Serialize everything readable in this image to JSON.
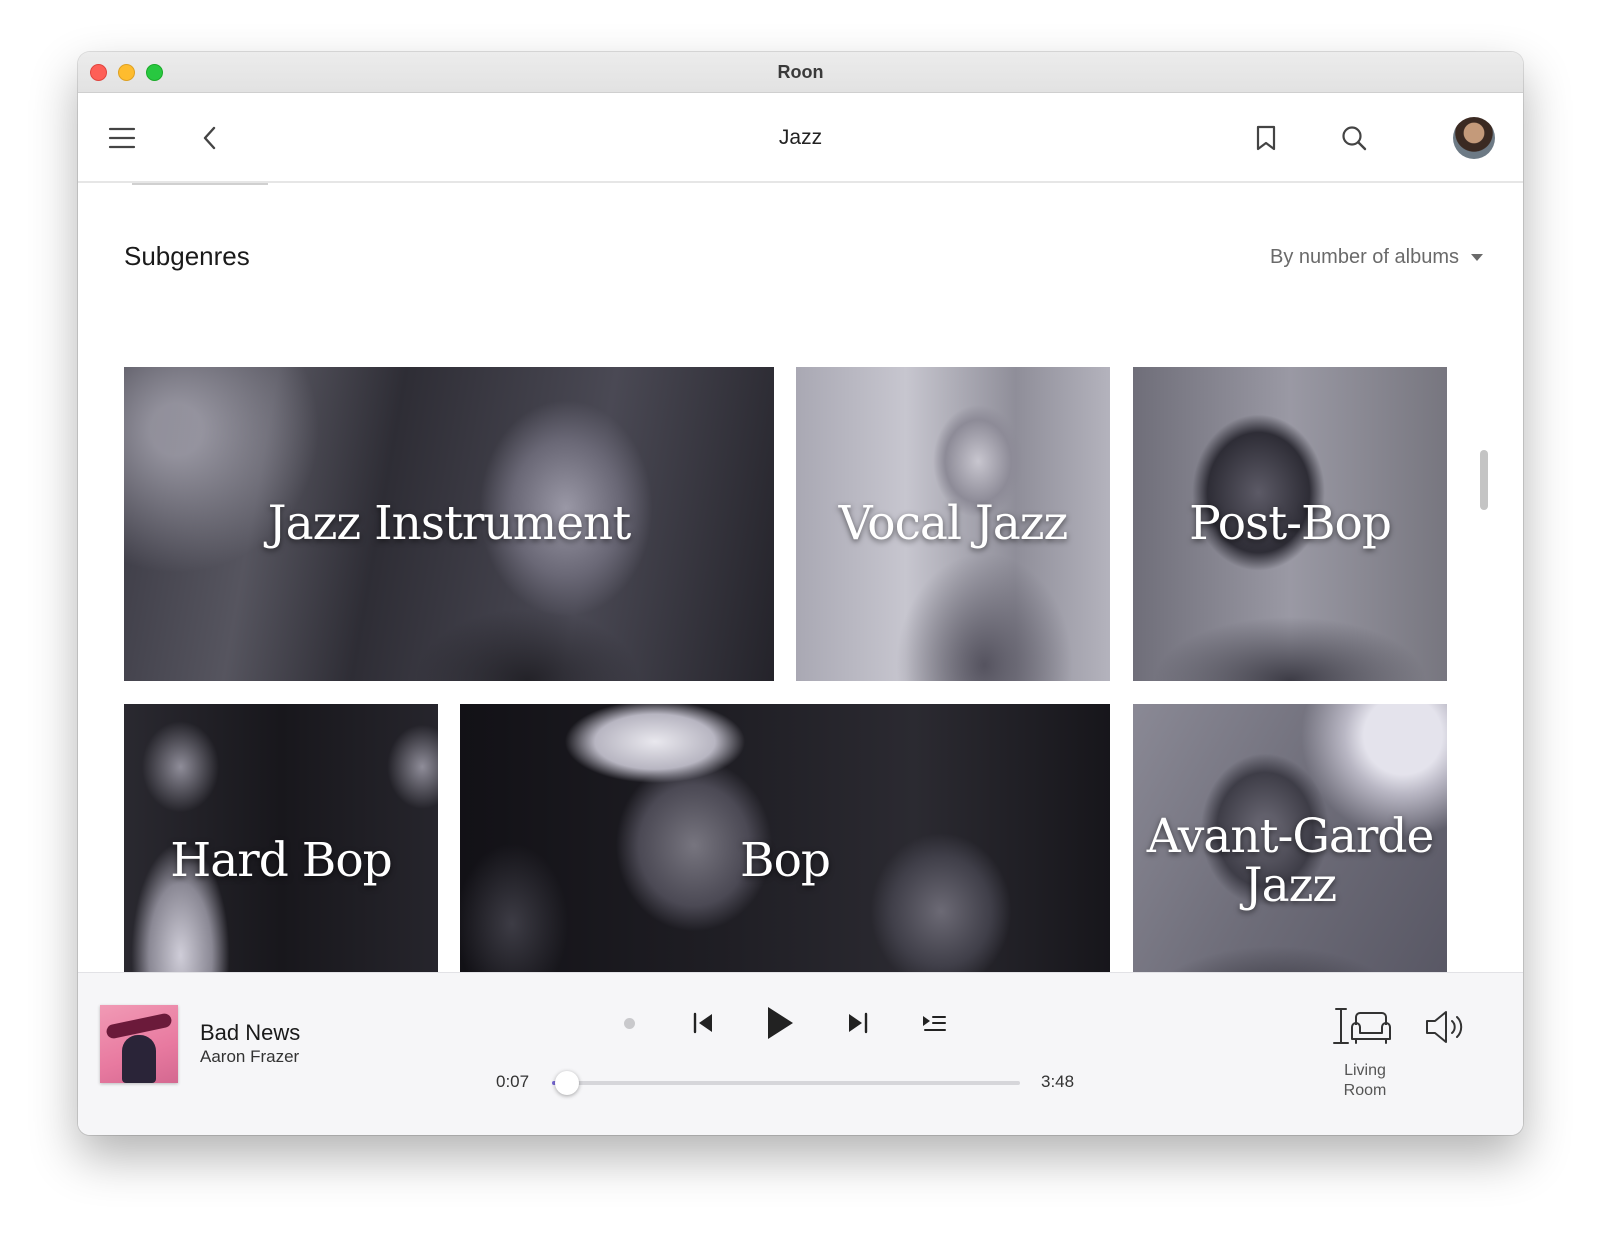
{
  "window": {
    "title": "Roon"
  },
  "nav": {
    "title": "Jazz"
  },
  "section": {
    "title": "Subgenres",
    "sort": "By number of albums"
  },
  "tiles": [
    {
      "label": "Jazz Instrument"
    },
    {
      "label": "Vocal Jazz"
    },
    {
      "label": "Post-Bop"
    },
    {
      "label": "Hard Bop"
    },
    {
      "label": "Bop"
    },
    {
      "label": "Avant-Garde Jazz"
    }
  ],
  "player": {
    "track": "Bad News",
    "artist": "Aaron Frazer",
    "elapsed": "0:07",
    "total": "3:48",
    "progress": 0.031,
    "zone": "Living Room"
  },
  "icons": {
    "menu": "hamburger-icon",
    "back": "chevron-left-icon",
    "bookmark": "bookmark-icon",
    "search": "search-icon",
    "previous": "skip-previous-icon",
    "play": "play-icon",
    "next": "skip-next-icon",
    "queue": "queue-icon",
    "zone": "zone-speaker-chair-icon",
    "volume": "volume-icon"
  },
  "colors": {
    "accent": "#7a6bd8"
  }
}
